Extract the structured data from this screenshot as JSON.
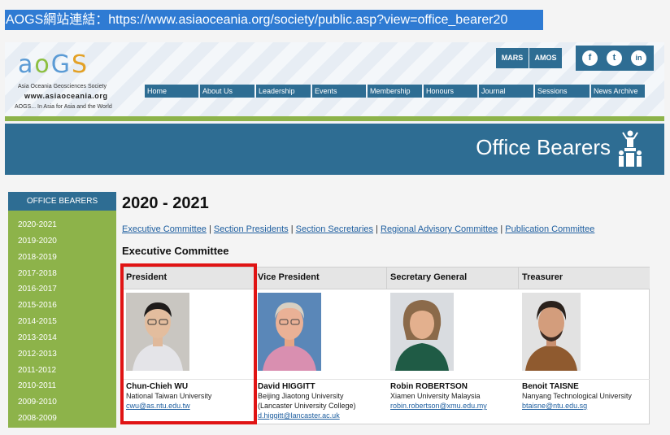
{
  "url_bar": {
    "text": "AOGS網站連結：https://www.asiaoceania.org/society/public.asp?view=office_bearer20"
  },
  "logo": {
    "rings": [
      "a",
      "o",
      "G",
      "S"
    ],
    "line1": "Asia Oceania Geosciences Society",
    "line2": "www.asiaoceania.org",
    "line3": "AOGS... In Asia for Asia and the World"
  },
  "top_links": {
    "mars": "MARS",
    "amos": "AMOS"
  },
  "social": {
    "facebook": "f",
    "twitter": "t",
    "linkedin": "in"
  },
  "nav": [
    "Home",
    "About Us",
    "Leadership",
    "Events",
    "Membership",
    "Honours",
    "Journal",
    "Sessions",
    "News Archive"
  ],
  "banner": {
    "title": "Office Bearers"
  },
  "sidebar": {
    "heading": "OFFICE BEARERS",
    "years": [
      "2020-2021",
      "2019-2020",
      "2018-2019",
      "2017-2018",
      "2016-2017",
      "2015-2016",
      "2014-2015",
      "2013-2014",
      "2012-2013",
      "2011-2012",
      "2010-2011",
      "2009-2010",
      "2008-2009"
    ]
  },
  "main": {
    "year_title": "2020 - 2021",
    "links": [
      "Executive Committee",
      "Section Presidents",
      "Section Secretaries",
      "Regional Advisory Committee",
      "Publication Committee"
    ],
    "separator": " | ",
    "section_title": "Executive Committee"
  },
  "committee": [
    {
      "role": "President",
      "name": "Chun-Chieh WU",
      "institution": [
        "National Taiwan University"
      ],
      "email": "cwu@as.ntu.edu.tw"
    },
    {
      "role": "Vice President",
      "name": "David HIGGITT",
      "institution": [
        "Beijing Jiaotong University",
        "(Lancaster University College)"
      ],
      "email": "d.higgitt@lancaster.ac.uk"
    },
    {
      "role": "Secretary General",
      "name": "Robin ROBERTSON",
      "institution": [
        "Xiamen University Malaysia"
      ],
      "email": "robin.robertson@xmu.edu.my"
    },
    {
      "role": "Treasurer",
      "name": "Benoit TAISNE",
      "institution": [
        "Nanyang Technological University"
      ],
      "email": "btaisne@ntu.edu.sg"
    }
  ],
  "colors": {
    "brand_blue": "#2e6d93",
    "green": "#8db34a",
    "highlight_red": "#e01414",
    "url_blue": "#2f7bd3"
  }
}
